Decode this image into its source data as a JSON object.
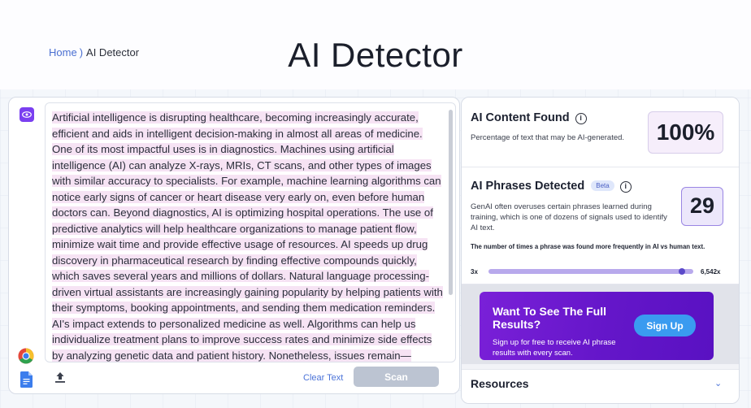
{
  "breadcrumb": {
    "home": "Home",
    "separator": ")",
    "current": "AI Detector"
  },
  "page_title": "AI Detector",
  "editor": {
    "text": "Artificial intelligence is disrupting healthcare, becoming increasingly accurate, efficient and aids in intelligent decision-making in almost all areas of medicine. One of its most impactful uses is in diagnostics. Machines using artificial intelligence (AI) can analyze X-rays, MRIs, CT scans, and other types of images with similar accuracy to specialists. For example, machine learning algorithms can notice early signs of cancer or heart disease very early on, even before human doctors can. Beyond diagnostics, AI is optimizing hospital operations. The use of predictive analytics will help healthcare organizations to manage patient flow, minimize wait time and provide effective usage of resources. AI speeds up drug discovery in pharmaceutical research by finding effective compounds quickly, which saves several years and millions of dollars. Natural language processing-driven virtual assistants are increasingly gaining popularity by helping patients with their symptoms, booking appointments, and sending them medication reminders. AI's impact extends to personalized medicine as well. Algorithms can help us individualize treatment plans to improve success rates and minimize side effects by analyzing genetic data and patient history. Nonetheless, issues remain—especially",
    "clear_label": "Clear Text",
    "scan_label": "Scan"
  },
  "ai_content": {
    "title": "AI Content Found",
    "description": "Percentage of text that may be AI-generated.",
    "score": "100%"
  },
  "ai_phrases": {
    "title": "AI Phrases Detected",
    "badge": "Beta",
    "description": "GenAI often overuses certain phrases learned during training, which is one of dozens of signals used to identify AI text.",
    "count": "29",
    "frequency_note": "The number of times a phrase was found more frequently in AI vs human text.",
    "range_min": "3x",
    "range_max": "6,542x",
    "range_position": 0.96
  },
  "promo": {
    "title": "Want To See The Full Results?",
    "subtitle": "Sign up for free to receive AI phrase results with every scan.",
    "signup_label": "Sign Up"
  },
  "resources": {
    "title": "Resources"
  },
  "colors": {
    "accent": "#7a3ff0",
    "link": "#4b73d8",
    "promo": "#6a18cc",
    "signup": "#3a9bf0"
  }
}
